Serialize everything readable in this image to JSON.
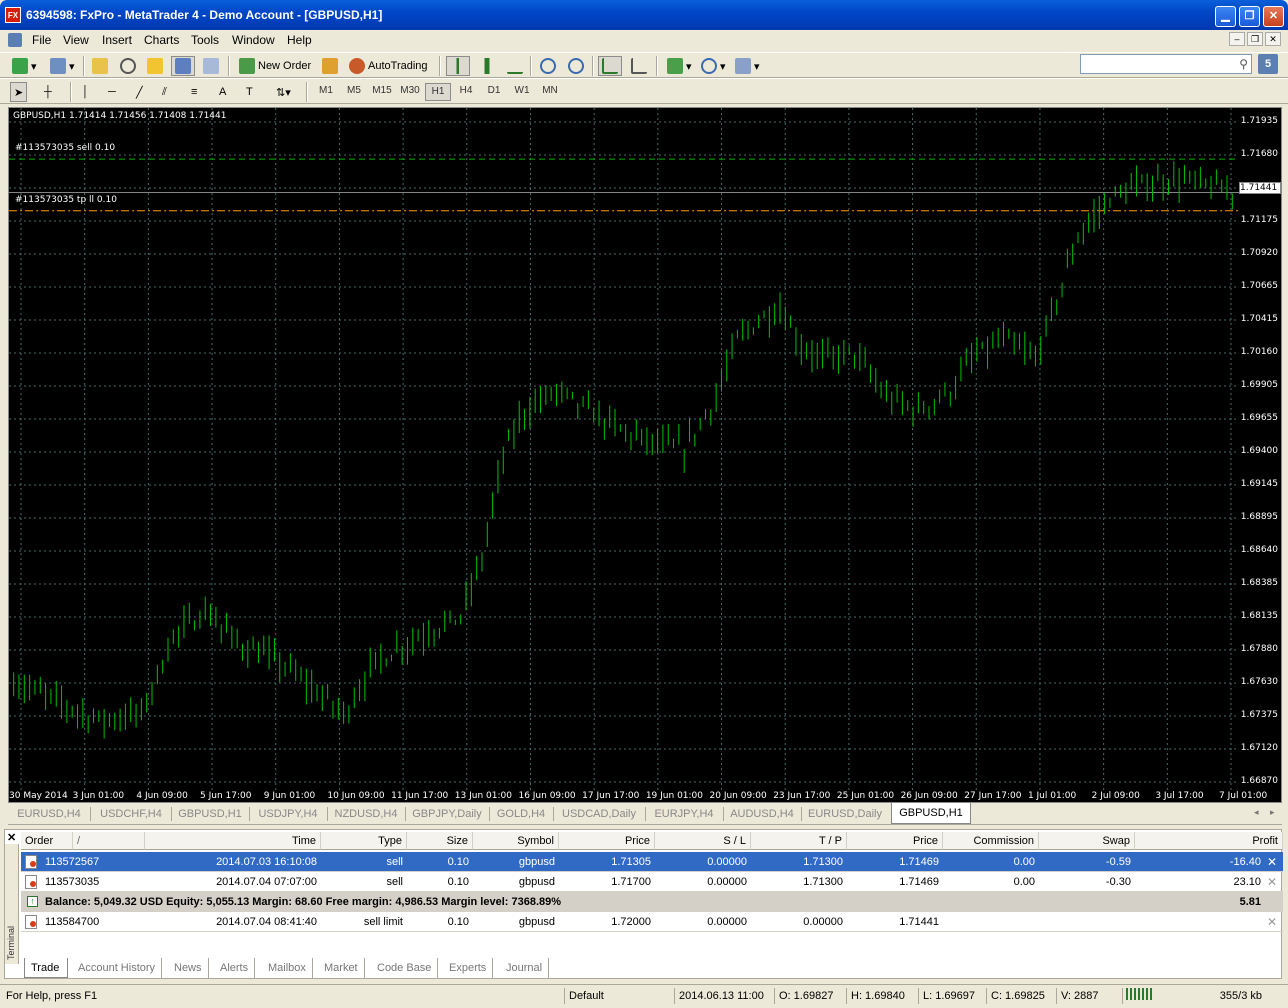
{
  "window": {
    "title": "6394598: FxPro - MetaTrader 4 - Demo Account - [GBPUSD,H1]",
    "icon_text": "FX"
  },
  "menu": [
    "File",
    "View",
    "Insert",
    "Charts",
    "Tools",
    "Window",
    "Help"
  ],
  "toolbar": {
    "new_order_label": "New Order",
    "autotrading_label": "AutoTrading",
    "badge": "5",
    "timeframes": [
      "M1",
      "M5",
      "M15",
      "M30",
      "H1",
      "H4",
      "D1",
      "W1",
      "MN"
    ],
    "active_timeframe": "H1"
  },
  "chart": {
    "header": "GBPUSD,H1  1.71414 1.71456 1.71408 1.71441",
    "order_label_1": "#113573035 sell 0.10",
    "order_label_2": "#113573035 tp ll 0.10",
    "current_price": "1.71441",
    "colors": {
      "background": "#000000",
      "grid": "#4a6a6a",
      "bars": "#00c000",
      "order_line": "#00b000",
      "tp_line": "#ff9900"
    }
  },
  "chart_data": {
    "type": "ohlc",
    "symbol": "GBPUSD",
    "timeframe": "H1",
    "grid": true,
    "y_ticks": [
      "1.71935",
      "1.71680",
      "1.71441",
      "1.71175",
      "1.70920",
      "1.70665",
      "1.70415",
      "1.70160",
      "1.69905",
      "1.69655",
      "1.69400",
      "1.69145",
      "1.68895",
      "1.68640",
      "1.68385",
      "1.68135",
      "1.67880",
      "1.67630",
      "1.67375",
      "1.67120",
      "1.66870"
    ],
    "x_ticks": [
      "30 May 2014",
      "3 Jun 01:00",
      "4 Jun 09:00",
      "5 Jun 17:00",
      "9 Jun 01:00",
      "10 Jun 09:00",
      "11 Jun 17:00",
      "13 Jun 01:00",
      "16 Jun 09:00",
      "17 Jun 17:00",
      "19 Jun 01:00",
      "20 Jun 09:00",
      "23 Jun 17:00",
      "25 Jun 01:00",
      "26 Jun 09:00",
      "27 Jun 17:00",
      "1 Jul 01:00",
      "2 Jul 09:00",
      "3 Jul 17:00",
      "7 Jul 01:00"
    ],
    "ylim": [
      1.6687,
      1.7205
    ],
    "trend_anchors": [
      [
        0,
        1.6765
      ],
      [
        8,
        1.675
      ],
      [
        16,
        1.6735
      ],
      [
        24,
        1.674
      ],
      [
        30,
        1.68
      ],
      [
        36,
        1.682
      ],
      [
        42,
        1.6795
      ],
      [
        50,
        1.678
      ],
      [
        56,
        1.676
      ],
      [
        62,
        1.674
      ],
      [
        68,
        1.678
      ],
      [
        76,
        1.68
      ],
      [
        84,
        1.6815
      ],
      [
        88,
        1.686
      ],
      [
        92,
        1.694
      ],
      [
        96,
        1.6975
      ],
      [
        102,
        1.699
      ],
      [
        108,
        1.6975
      ],
      [
        114,
        1.696
      ],
      [
        120,
        1.695
      ],
      [
        126,
        1.6945
      ],
      [
        132,
        1.6985
      ],
      [
        136,
        1.703
      ],
      [
        140,
        1.7045
      ],
      [
        144,
        1.7055
      ],
      [
        148,
        1.7025
      ],
      [
        152,
        1.7015
      ],
      [
        158,
        1.702
      ],
      [
        164,
        1.6985
      ],
      [
        170,
        1.6975
      ],
      [
        176,
        1.699
      ],
      [
        180,
        1.7015
      ],
      [
        186,
        1.703
      ],
      [
        192,
        1.7015
      ],
      [
        196,
        1.706
      ],
      [
        200,
        1.711
      ],
      [
        206,
        1.714
      ],
      [
        212,
        1.715
      ],
      [
        218,
        1.7155
      ],
      [
        224,
        1.715
      ],
      [
        229,
        1.7144
      ]
    ],
    "orders": [
      {
        "label": "#113573035 sell 0.10",
        "price": 1.717
      },
      {
        "label": "#113573035 tp ll 0.10",
        "price": 1.713
      }
    ],
    "current_price": 1.71441
  },
  "chart_tabs": [
    "EURUSD,H4",
    "USDCHF,H4",
    "GBPUSD,H1",
    "USDJPY,H4",
    "NZDUSD,H4",
    "GBPJPY,Daily",
    "GOLD,H4",
    "USDCAD,Daily",
    "EURJPY,H4",
    "AUDUSD,H4",
    "EURUSD,Daily",
    "GBPUSD,H1"
  ],
  "terminal": {
    "side_label": "Terminal",
    "columns": [
      "Order",
      "/",
      "Time",
      "Type",
      "Size",
      "Symbol",
      "Price",
      "S / L",
      "T / P",
      "Price",
      "Commission",
      "Swap",
      "Profit"
    ],
    "rows": [
      {
        "order": "113572567",
        "time": "2014.07.03 16:10:08",
        "type": "sell",
        "size": "0.10",
        "symbol": "gbpusd",
        "price": "1.71305",
        "sl": "0.00000",
        "tp": "1.71300",
        "cur_price": "1.71469",
        "commission": "0.00",
        "swap": "-0.59",
        "profit": "-16.40"
      },
      {
        "order": "113573035",
        "time": "2014.07.04 07:07:00",
        "type": "sell",
        "size": "0.10",
        "symbol": "gbpusd",
        "price": "1.71700",
        "sl": "0.00000",
        "tp": "1.71300",
        "cur_price": "1.71469",
        "commission": "0.00",
        "swap": "-0.30",
        "profit": "23.10"
      }
    ],
    "balance_text": "Balance: 5,049.32 USD  Equity: 5,055.13  Margin: 68.60  Free margin: 4,986.53  Margin level: 7368.89%",
    "balance_profit": "5.81",
    "pending": {
      "order": "113584700",
      "time": "2014.07.04 08:41:40",
      "type": "sell limit",
      "size": "0.10",
      "symbol": "gbpusd",
      "price": "1.72000",
      "sl": "0.00000",
      "tp": "0.00000",
      "cur_price": "1.71441"
    },
    "tabs": [
      "Trade",
      "Account History",
      "News",
      "Alerts",
      "Mailbox",
      "Market",
      "Code Base",
      "Experts",
      "Journal"
    ]
  },
  "status": {
    "help": "For Help, press F1",
    "profile": "Default",
    "datetime": "2014.06.13 11:00",
    "open": "O: 1.69827",
    "high": "H: 1.69840",
    "low": "L: 1.69697",
    "close": "C: 1.69825",
    "volume": "V: 2887",
    "traffic": "355/3 kb"
  }
}
